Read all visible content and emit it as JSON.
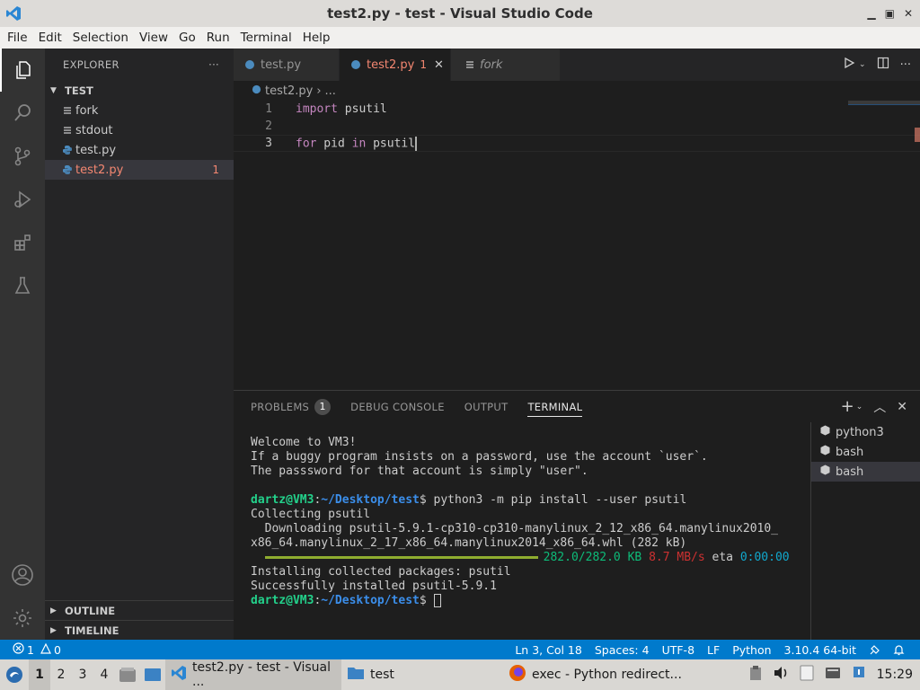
{
  "window": {
    "title": "test2.py - test - Visual Studio Code"
  },
  "menu": [
    "File",
    "Edit",
    "Selection",
    "View",
    "Go",
    "Run",
    "Terminal",
    "Help"
  ],
  "sidebar": {
    "title": "EXPLORER",
    "folder": "TEST",
    "files": [
      {
        "name": "fork",
        "badge": ""
      },
      {
        "name": "stdout",
        "badge": ""
      },
      {
        "name": "test.py",
        "badge": ""
      },
      {
        "name": "test2.py",
        "badge": "1"
      }
    ],
    "outline": "OUTLINE",
    "timeline": "TIMELINE"
  },
  "tabs": [
    {
      "label": "test.py"
    },
    {
      "label": "test2.py",
      "count": "1"
    },
    {
      "label": "fork"
    }
  ],
  "breadcrumb": {
    "file": "test2.py",
    "rest": "..."
  },
  "editor": {
    "lines": [
      {
        "num": "1",
        "kw": "import",
        "rest": " psutil"
      },
      {
        "num": "2",
        "kw": "",
        "rest": ""
      },
      {
        "num": "3",
        "kw": "for",
        "mid": " pid ",
        "kw2": "in",
        "rest": " psutil"
      }
    ]
  },
  "panel": {
    "tabs": [
      "PROBLEMS",
      "DEBUG CONSOLE",
      "OUTPUT",
      "TERMINAL"
    ],
    "problems_count": "1",
    "terminals": [
      "python3",
      "bash",
      "bash"
    ]
  },
  "terminal": {
    "l1": "Welcome to VM3!",
    "l2": "If a buggy program insists on a password, use the account `user`.",
    "l3": "The passsword for that account is simply \"user\".",
    "user": "dartz@VM3",
    "colon": ":",
    "path": "~/Desktop/test",
    "dollar": "$",
    "cmd": " python3 -m pip install --user psutil",
    "l5": "Collecting psutil",
    "l6": "  Downloading psutil-5.9.1-cp310-cp310-manylinux_2_12_x86_64.manylinux2010_",
    "l7": "x86_64.manylinux_2_17_x86_64.manylinux2014_x86_64.whl (282 kB)",
    "progress_size": "282.0/282.0 KB",
    "progress_speed": "8.7 MB/s",
    "progress_eta_label": " eta ",
    "progress_eta": "0:00:00",
    "l9": "Installing collected packages: psutil",
    "l10": "Successfully installed psutil-5.9.1"
  },
  "statusbar": {
    "errors": "1",
    "warnings": "0",
    "position": "Ln 3, Col 18",
    "spaces": "Spaces: 4",
    "encoding": "UTF-8",
    "eol": "LF",
    "language": "Python",
    "interpreter": "3.10.4 64-bit"
  },
  "taskbar": {
    "workspaces": [
      "1",
      "2",
      "3",
      "4"
    ],
    "tasks": [
      {
        "label": "test2.py - test - Visual ..."
      },
      {
        "label": "test"
      },
      {
        "label": "exec - Python redirect..."
      }
    ],
    "clock": "15:29"
  },
  "colors": {
    "accent": "#007acc",
    "error": "#f48771",
    "keyword": "#c586c0"
  }
}
